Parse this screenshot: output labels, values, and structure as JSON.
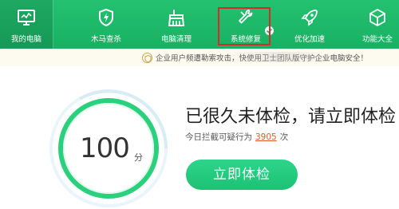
{
  "nav": {
    "tabs": [
      {
        "label": "我的电脑",
        "icon": "monitor-icon"
      },
      {
        "label": "木马查杀",
        "icon": "shield-lightning-icon"
      },
      {
        "label": "电脑清理",
        "icon": "broom-icon"
      },
      {
        "label": "系统修复",
        "icon": "wrench-icon"
      },
      {
        "label": "优化加速",
        "icon": "rocket-icon"
      },
      {
        "label": "功能大全",
        "icon": "cube-icon"
      }
    ]
  },
  "notice": {
    "text": "企业用户频遭勒索攻击，快使用卫士团队版守护企业电脑安全！"
  },
  "score": {
    "value": "100",
    "unit": "分"
  },
  "main": {
    "headline": "已很久未体检，请立即体检",
    "intercept_prefix": "今日拦截可疑行为",
    "intercept_count": "3905",
    "intercept_suffix": "次",
    "check_button": "立即体检"
  },
  "colors": {
    "nav_green": "#1cb667",
    "highlight_red": "#d52b2b",
    "button_green": "#22c97b",
    "count_orange": "#e25b24"
  }
}
